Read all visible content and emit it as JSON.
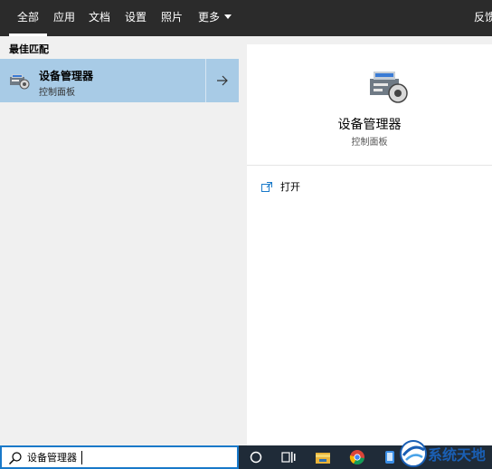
{
  "tabs": [
    {
      "label": "全部"
    },
    {
      "label": "应用"
    },
    {
      "label": "文档"
    },
    {
      "label": "设置"
    },
    {
      "label": "照片"
    },
    {
      "label": "更多"
    }
  ],
  "tab_right_label": "反馈",
  "left_pane": {
    "section_title": "最佳匹配",
    "result": {
      "title": "设备管理器",
      "subtitle": "控制面板"
    }
  },
  "detail": {
    "title": "设备管理器",
    "subtitle": "控制面板",
    "actions": [
      {
        "label": "打开"
      }
    ]
  },
  "search": {
    "value": "设备管理器"
  },
  "taskbar": {
    "items": [
      "cortana-icon",
      "task-view-icon",
      "file-explorer-icon",
      "chrome-icon",
      "phone-app-icon"
    ]
  },
  "watermark": {
    "text": "系统天地"
  },
  "colors": {
    "topbar": "#2b2b2b",
    "selected": "#a8cbe6",
    "search_border": "#1979c9",
    "taskbar": "#1f2b38"
  }
}
